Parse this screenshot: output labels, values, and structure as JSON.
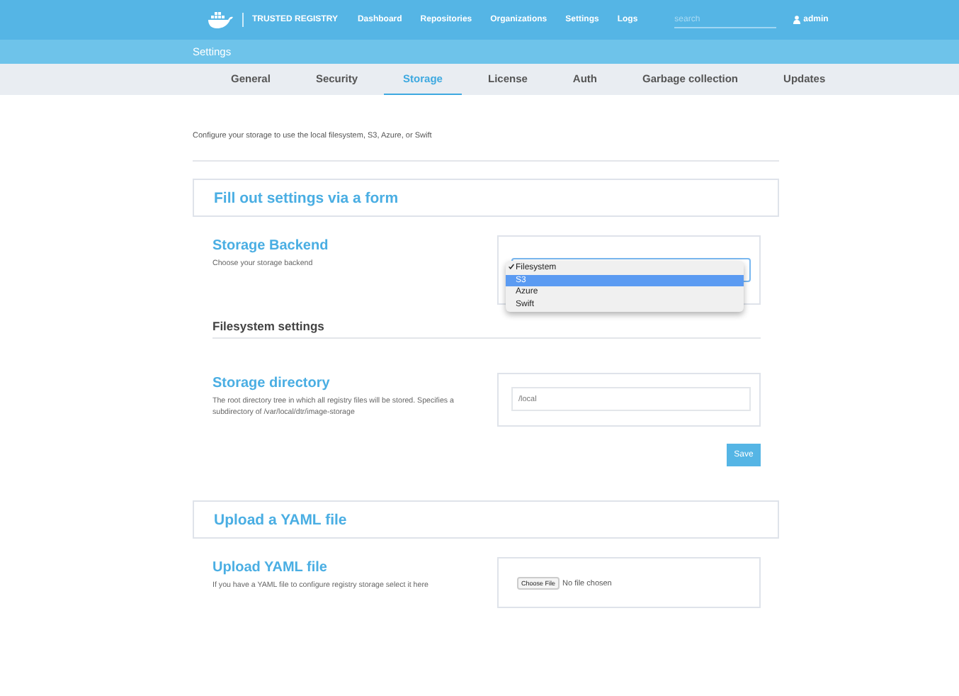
{
  "header": {
    "brand": "TRUSTED REGISTRY",
    "nav": [
      {
        "label": "Dashboard"
      },
      {
        "label": "Repositories"
      },
      {
        "label": "Organizations"
      },
      {
        "label": "Settings"
      },
      {
        "label": "Logs"
      }
    ],
    "search": {
      "placeholder": "search"
    },
    "user": "admin"
  },
  "page_title": "Settings",
  "tabs": [
    {
      "label": "General",
      "selected": false
    },
    {
      "label": "Security",
      "selected": false
    },
    {
      "label": "Storage",
      "selected": true
    },
    {
      "label": "License",
      "selected": false
    },
    {
      "label": "Auth",
      "selected": false
    },
    {
      "label": "Garbage collection",
      "selected": false
    },
    {
      "label": "Updates",
      "selected": false
    }
  ],
  "intro": "Configure your storage to use the local filesystem, S3, Azure, or Swift",
  "form_section": {
    "title": "Fill out settings via a form",
    "backend": {
      "title": "Storage Backend",
      "description": "Choose your storage backend",
      "dropdown": {
        "expanded": true,
        "options": [
          {
            "label": "Filesystem",
            "selected": true,
            "highlighted": false
          },
          {
            "label": "S3",
            "selected": false,
            "highlighted": true
          },
          {
            "label": "Azure",
            "selected": false,
            "highlighted": false
          },
          {
            "label": "Swift",
            "selected": false,
            "highlighted": false
          }
        ]
      }
    },
    "subsection": "Filesystem settings",
    "directory": {
      "title": "Storage directory",
      "description": "The root directory tree in which all registry files will be stored. Specifies a subdirectory of /var/local/dtr/image-storage",
      "value": "/local"
    },
    "save": "Save"
  },
  "upload_section": {
    "title": "Upload a YAML file",
    "field": {
      "title": "Upload YAML file",
      "description": "If you have a YAML file to configure registry storage select it here",
      "button": "Choose File",
      "status": "No file chosen"
    }
  }
}
